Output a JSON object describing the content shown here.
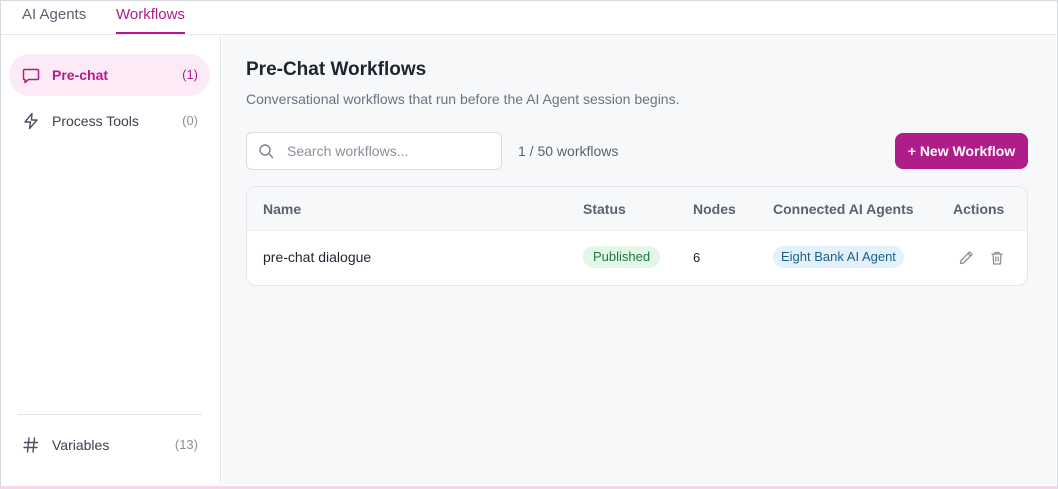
{
  "tabs": [
    {
      "label": "AI Agents",
      "active": false
    },
    {
      "label": "Workflows",
      "active": true
    }
  ],
  "sidebar": {
    "items": [
      {
        "label": "Pre-chat",
        "count": "(1)",
        "icon": "chat-bubble-icon",
        "active": true
      },
      {
        "label": "Process Tools",
        "count": "(0)",
        "icon": "lightning-icon",
        "active": false
      }
    ],
    "footer": {
      "label": "Variables",
      "count": "(13)",
      "icon": "hash-icon"
    }
  },
  "main": {
    "title": "Pre-Chat Workflows",
    "subtitle": "Conversational workflows that run before the AI Agent session begins.",
    "search_placeholder": "Search workflows...",
    "workflow_count": "1 / 50 workflows",
    "new_button": "+ New Workflow"
  },
  "table": {
    "columns": [
      "Name",
      "Status",
      "Nodes",
      "Connected AI Agents",
      "Actions"
    ],
    "rows": [
      {
        "name": "pre-chat dialogue",
        "status": "Published",
        "nodes": "6",
        "agents": "Eight Bank AI Agent"
      }
    ]
  },
  "colors": {
    "accent": "#b01c8a",
    "status_published": "#1f7a3e",
    "agent_badge": "#1d5f87"
  }
}
